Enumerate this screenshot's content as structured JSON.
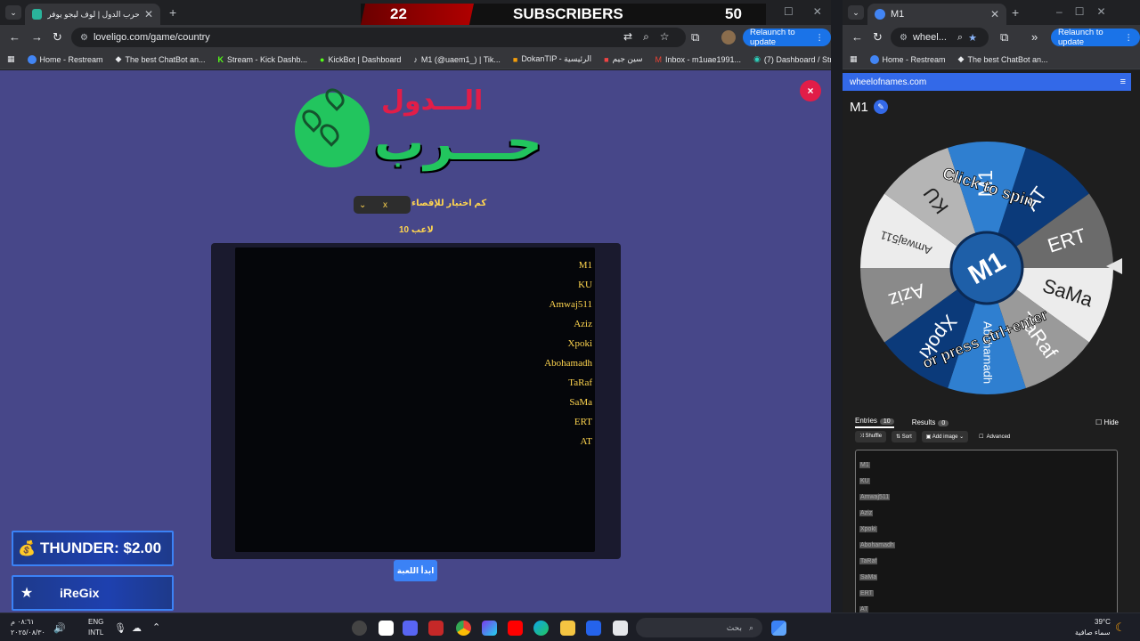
{
  "left_browser": {
    "tab_title": "لعبة حرب الدول | لوف ليجو يوفر",
    "url": "loveligo.com/game/country",
    "relaunch_label": "Relaunch to update",
    "bookmarks": [
      "Home - Restream",
      "The best ChatBot an...",
      "Stream - Kick Dashb...",
      "KickBot | Dashboard",
      "M1 (@uaem1_) | Tik...",
      "DokanTIP - الرئيسية",
      "سين جيم",
      "Inbox - m1uae1991...",
      "(7) Dashboard / Stre..."
    ]
  },
  "subscriber_bar": {
    "current": "22",
    "label": "SUBSCRIBERS",
    "goal": "50"
  },
  "game": {
    "logo_title": "الـــدول",
    "logo_subtitle": "حـــرب",
    "close_label": "×",
    "select_value": "x",
    "select_label": "كم اختيار للإقصاء",
    "players_count_label": "10 لاعب",
    "players": [
      "M1",
      "KU",
      "Amwaj511",
      "Aziz",
      "Xpoki",
      "Abohamadh",
      "TaRaf",
      "SaMa",
      "ERT",
      "AT"
    ],
    "start_button": "ابدأ اللعبة"
  },
  "overlay": {
    "thunder_label": "THUNDER: $2.00",
    "donor_name": "iReGix"
  },
  "right_browser": {
    "tab_title": "M1",
    "url": "wheel...",
    "relaunch_label": "Relaunch to update",
    "bookmarks": [
      "Home - Restream",
      "The best ChatBot an..."
    ]
  },
  "wheel_app": {
    "brand": "wheelofnames.com",
    "wheel_name": "M1",
    "hub_label": "M1",
    "spin_hint_1": "Click to spin",
    "spin_hint_2": "or press ctrl+enter",
    "segments": [
      "AT",
      "ERT",
      "SaMa",
      "TaRaf",
      "Abohamadh",
      "Xpoki",
      "Aziz",
      "Amwaj511",
      "KU",
      "M1"
    ],
    "tab_entries": "Entries",
    "entries_count": "10",
    "tab_results": "Results",
    "results_count": "0",
    "hide_label": "Hide",
    "shuffle_label": "Shuffle",
    "sort_label": "Sort",
    "add_image_label": "Add image",
    "advanced_label": "Advanced",
    "entries": [
      "M1",
      "KU",
      "Amwaj511",
      "Aziz",
      "Xpoki",
      "Abohamadh",
      "TaRaf",
      "SaMa",
      "ERT",
      "AT"
    ]
  },
  "taskbar": {
    "clock_time": "٠٨:٦١ م",
    "clock_date": "٢٠٢٥/٠٨/٣٠",
    "lang_1": "ENG",
    "lang_2": "INTL",
    "search_placeholder": "بحث",
    "weather_temp": "39°C",
    "weather_desc": "سماء صافية"
  }
}
